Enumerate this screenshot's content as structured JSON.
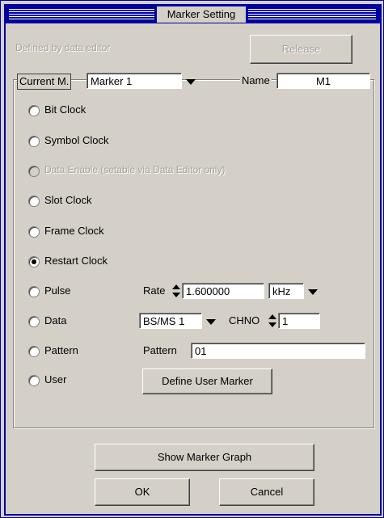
{
  "window": {
    "title": "Marker Setting"
  },
  "top": {
    "defined_label": "Defined by data editor",
    "release_label": "Release"
  },
  "marker_select": {
    "current_label": "Current M.",
    "current_value": "Marker 1",
    "name_label": "Name",
    "name_value": "M1"
  },
  "options": [
    {
      "label": "Bit Clock",
      "checked": false,
      "enabled": true
    },
    {
      "label": "Symbol Clock",
      "checked": false,
      "enabled": true
    },
    {
      "label": "Data Enable (setable via Data Editor only)",
      "checked": false,
      "enabled": false
    },
    {
      "label": "Slot Clock",
      "checked": false,
      "enabled": true
    },
    {
      "label": "Frame Clock",
      "checked": false,
      "enabled": true
    },
    {
      "label": "Restart Clock",
      "checked": true,
      "enabled": true
    },
    {
      "label": "Pulse",
      "checked": false,
      "enabled": true
    },
    {
      "label": "Data",
      "checked": false,
      "enabled": true
    },
    {
      "label": "Pattern",
      "checked": false,
      "enabled": true
    },
    {
      "label": "User",
      "checked": false,
      "enabled": true
    }
  ],
  "pulse": {
    "rate_label": "Rate",
    "rate_value": "1.600000",
    "unit_value": "kHz"
  },
  "data": {
    "source_value": "BS/MS 1",
    "chno_label": "CHNO",
    "chno_value": "1"
  },
  "pattern": {
    "label": "Pattern",
    "value": "01"
  },
  "user": {
    "define_button": "Define User Marker"
  },
  "footer": {
    "show_graph_button": "Show Marker Graph",
    "ok_button": "OK",
    "cancel_button": "Cancel"
  },
  "colors": {
    "title_bar": "#0000a0",
    "face": "#d4d0c8"
  }
}
